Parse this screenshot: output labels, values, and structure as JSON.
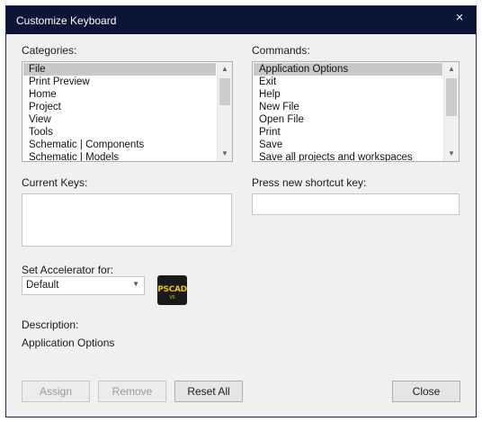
{
  "window": {
    "title": "Customize Keyboard",
    "close_glyph": "×"
  },
  "categories": {
    "label": "Categories:",
    "items": [
      "File",
      "Print Preview",
      "Home",
      "Project",
      "View",
      "Tools",
      "Schematic | Components",
      "Schematic | Models"
    ],
    "selected": "File"
  },
  "commands": {
    "label": "Commands:",
    "items": [
      "Application Options",
      "Exit",
      "Help",
      "New File",
      "Open File",
      "Print",
      "Save",
      "Save all projects and workspaces"
    ],
    "selected": "Application Options"
  },
  "current_keys": {
    "label": "Current Keys:"
  },
  "shortcut": {
    "label": "Press new shortcut key:",
    "value": ""
  },
  "accelerator": {
    "label": "Set Accelerator for:",
    "value": "Default"
  },
  "logo": {
    "text": "PSCAD",
    "version": "V5",
    "icon": "pscad-logo-icon"
  },
  "description": {
    "label": "Description:",
    "text": "Application Options"
  },
  "buttons": {
    "assign": "Assign",
    "remove": "Remove",
    "reset_all": "Reset All",
    "close": "Close"
  },
  "scroll_glyphs": {
    "up": "▲",
    "down": "▼",
    "dropdown": "▼"
  }
}
